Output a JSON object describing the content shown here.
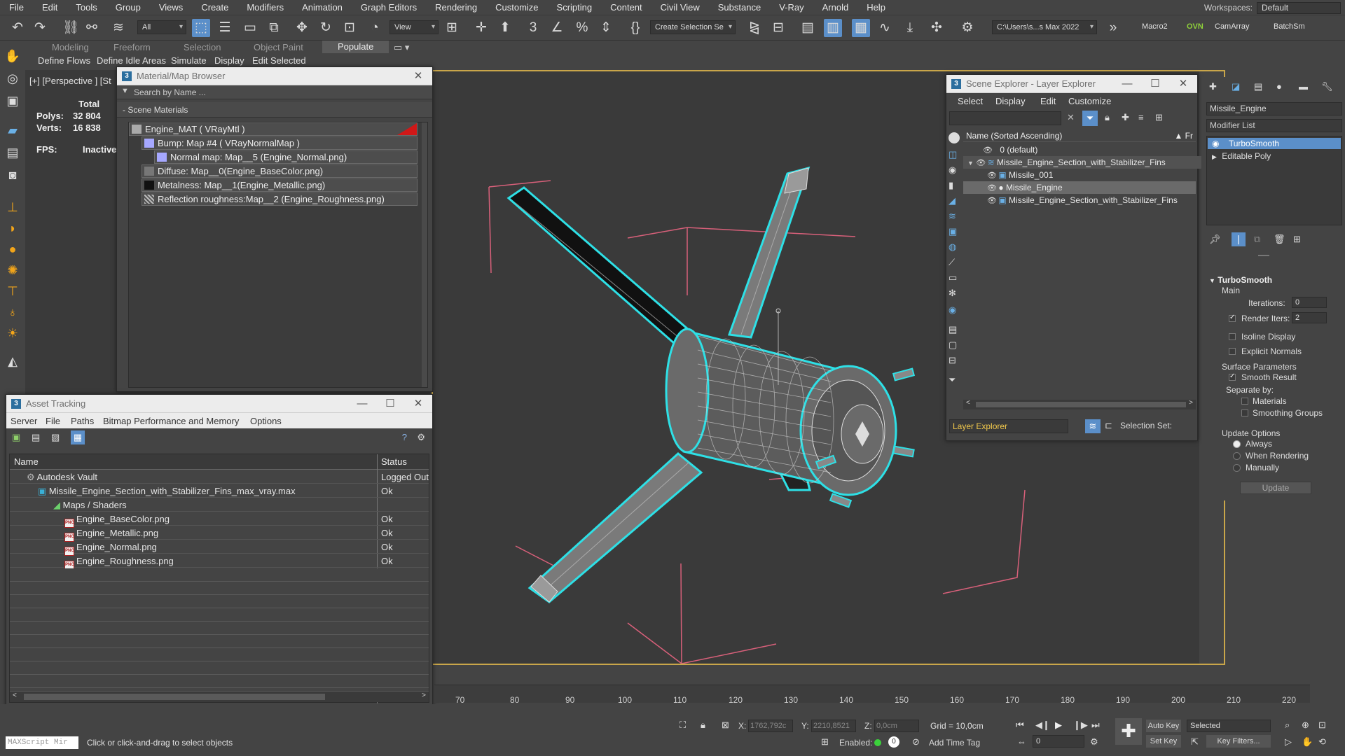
{
  "menu": [
    "File",
    "Edit",
    "Tools",
    "Group",
    "Views",
    "Create",
    "Modifiers",
    "Animation",
    "Graph Editors",
    "Rendering",
    "Customize",
    "Scripting",
    "Content",
    "Civil View",
    "Substance",
    "V-Ray",
    "Arnold",
    "Help"
  ],
  "workspaces": {
    "label": "Workspaces:",
    "value": "Default"
  },
  "toolbar": {
    "filter_dropdown": "All",
    "view_dropdown": "View",
    "create_selection": "Create Selection Se",
    "path_dropdown": "C:\\Users\\s...s Max 2022",
    "macro2": "Macro2",
    "ovn": "OVN",
    "camarray": "CamArray",
    "batchsm": "BatchSm"
  },
  "ribbon": {
    "tabs": [
      "Modeling",
      "Freeform",
      "Selection",
      "Object Paint",
      "Populate"
    ],
    "selected_tab": "Populate",
    "subitems": [
      "Define Flows",
      "Define Idle Areas",
      "Simulate",
      "Display",
      "Edit Selected"
    ]
  },
  "viewport": {
    "label": "[+] [Perspective ] [St",
    "stats": {
      "total_label": "Total",
      "polys_label": "Polys:",
      "polys": "32 804",
      "verts_label": "Verts:",
      "verts": "16 838",
      "fps_label": "FPS:",
      "fps": "Inactive"
    }
  },
  "material_browser": {
    "title": "Material/Map Browser",
    "search_placeholder": "Search by Name ...",
    "section": "- Scene Materials",
    "rows": [
      "Engine_MAT  ( VRayMtl )",
      "Bump: Map #4  ( VRayNormalMap )",
      "Normal map: Map__5 (Engine_Normal.png)",
      "Diffuse: Map__0(Engine_BaseColor.png)",
      "Metalness: Map__1(Engine_Metallic.png)",
      "Reflection roughness:Map__2 (Engine_Roughness.png)"
    ]
  },
  "asset_tracking": {
    "title": "Asset Tracking",
    "menu": [
      "Server",
      "File",
      "Paths",
      "Bitmap Performance and Memory",
      "Options"
    ],
    "columns": [
      "Name",
      "Status"
    ],
    "rows": [
      {
        "name": "Autodesk Vault",
        "status": "Logged Out"
      },
      {
        "name": "Missile_Engine_Section_with_Stabilizer_Fins_max_vray.max",
        "status": "Ok"
      },
      {
        "name": "Maps / Shaders",
        "status": ""
      },
      {
        "name": "Engine_BaseColor.png",
        "status": "Ok"
      },
      {
        "name": "Engine_Metallic.png",
        "status": "Ok"
      },
      {
        "name": "Engine_Normal.png",
        "status": "Ok"
      },
      {
        "name": "Engine_Roughness.png",
        "status": "Ok"
      }
    ]
  },
  "scene_explorer": {
    "title": "Scene Explorer - Layer Explorer",
    "menu": [
      "Select",
      "Display",
      "Edit",
      "Customize"
    ],
    "column": "Name (Sorted Ascending)",
    "column2": "Fr",
    "rows": [
      "0 (default)",
      "Missile_Engine_Section_with_Stabilizer_Fins",
      "Missile_001",
      "Missile_Engine",
      "Missile_Engine_Section_with_Stabilizer_Fins"
    ],
    "footer_dropdown": "Layer Explorer",
    "selection_set": "Selection Set:"
  },
  "command_panel": {
    "object_name": "Missile_Engine",
    "modifier_list": "Modifier List",
    "stack": [
      "TurboSmooth",
      "Editable Poly"
    ],
    "rollout": "TurboSmooth",
    "main": "Main",
    "iterations_label": "Iterations:",
    "iterations": "0",
    "render_iters_label": "Render Iters:",
    "render_iters": "2",
    "isoline": "Isoline Display",
    "explicit_normals": "Explicit Normals",
    "surface_params": "Surface Parameters",
    "smooth_result": "Smooth Result",
    "separate_by": "Separate by:",
    "materials": "Materials",
    "smoothing_groups": "Smoothing Groups",
    "update_options": "Update Options",
    "always": "Always",
    "when_rendering": "When Rendering",
    "manually": "Manually",
    "update_btn": "Update"
  },
  "timeline": {
    "ticks": [
      "70",
      "80",
      "90",
      "100",
      "110",
      "120",
      "130",
      "140",
      "150",
      "160",
      "170",
      "180",
      "190",
      "200",
      "210",
      "220"
    ]
  },
  "status": {
    "maxscript": "MAXScript Mir",
    "prompt": "Click or click-and-drag to select objects",
    "x_label": "X:",
    "x": "1762,792c",
    "y_label": "Y:",
    "y": "2210,8521",
    "z_label": "Z:",
    "z": "0,0cm",
    "grid": "Grid = 10,0cm",
    "enabled": "Enabled:",
    "add_time_tag": "Add Time Tag",
    "auto_key": "Auto Key",
    "set_key": "Set Key",
    "selected": "Selected",
    "key_filters": "Key Filters...",
    "frame": "0"
  }
}
